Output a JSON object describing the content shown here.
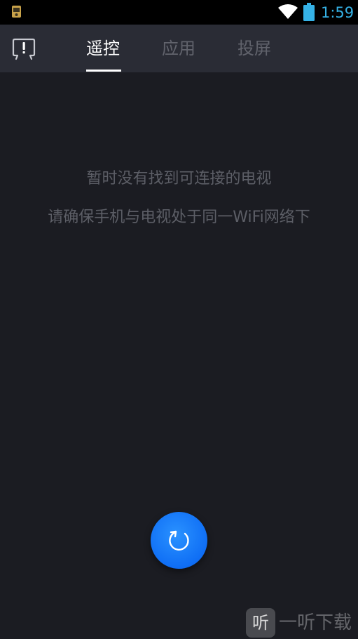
{
  "status_bar": {
    "time": "1:59",
    "icons": [
      "app-notification-icon",
      "wifi-icon",
      "battery-icon"
    ],
    "time_color": "#35b2e6"
  },
  "header": {
    "left_icon": "tv-alert-icon",
    "tabs": [
      {
        "label": "遥控",
        "active": true
      },
      {
        "label": "应用",
        "active": false
      },
      {
        "label": "投屏",
        "active": false
      }
    ]
  },
  "empty_state": {
    "line1": "暂时没有找到可连接的电视",
    "line2": "请确保手机与电视处于同一WiFi网络下"
  },
  "refresh_button": {
    "icon": "refresh-icon",
    "color": "#1a7cff"
  },
  "watermark": {
    "logo_char": "听",
    "text": "一听下载"
  },
  "colors": {
    "background": "#1b1c22",
    "header": "#2a2c35",
    "tab_inactive": "#61636c",
    "tab_active": "#ffffff",
    "message": "#5c5e66"
  }
}
